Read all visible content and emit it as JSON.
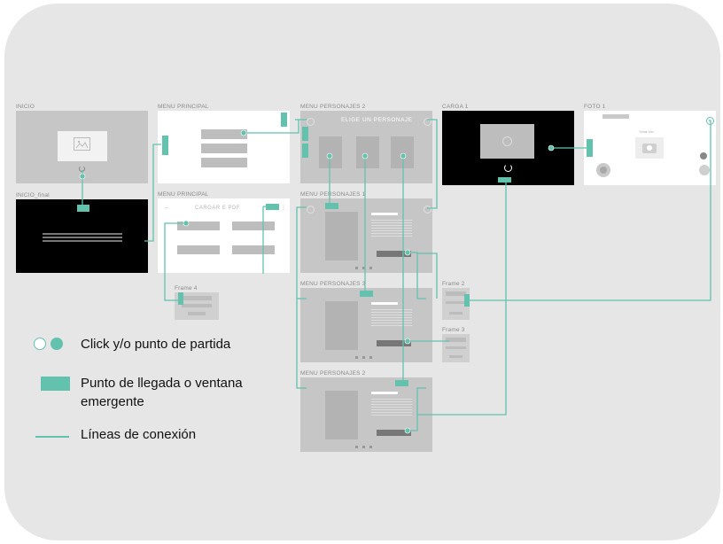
{
  "frames": {
    "inicio": "INICIO",
    "inicio_final": "INICIO_final",
    "menu_principal_1": "MENU PRINCIPAL",
    "menu_principal_2": "MENU PRINCIPAL",
    "menu_personajes_a": "MENU PERSONAJES 2",
    "menu_personajes_b": "MENU PERSONAJES 1",
    "menu_personajes_c": "MENU PERSONAJES 3",
    "menu_personajes_d": "MENU PERSONAJES 2",
    "carga": "CARGA 1",
    "foto": "FOTO 1",
    "frame4": "Frame 4",
    "frame2": "Frame 2",
    "frame3": "Frame 3"
  },
  "screens": {
    "elige_title": "ELIGE UN PERSONAJE",
    "cargar_title": "CARGAR E PDF",
    "tomar_foto": "Tomar foto"
  },
  "legend": {
    "click": "Click y/o punto de partida",
    "arrival_line1": "Punto de llegada o ventana",
    "arrival_line2": "emergente",
    "lines": "Líneas de conexión"
  },
  "colors": {
    "accent": "#62c2ae",
    "canvas": "#e6e6e6",
    "screen_grey": "#c6c6c6",
    "screen_black": "#000000",
    "label": "#8a8a8a"
  }
}
